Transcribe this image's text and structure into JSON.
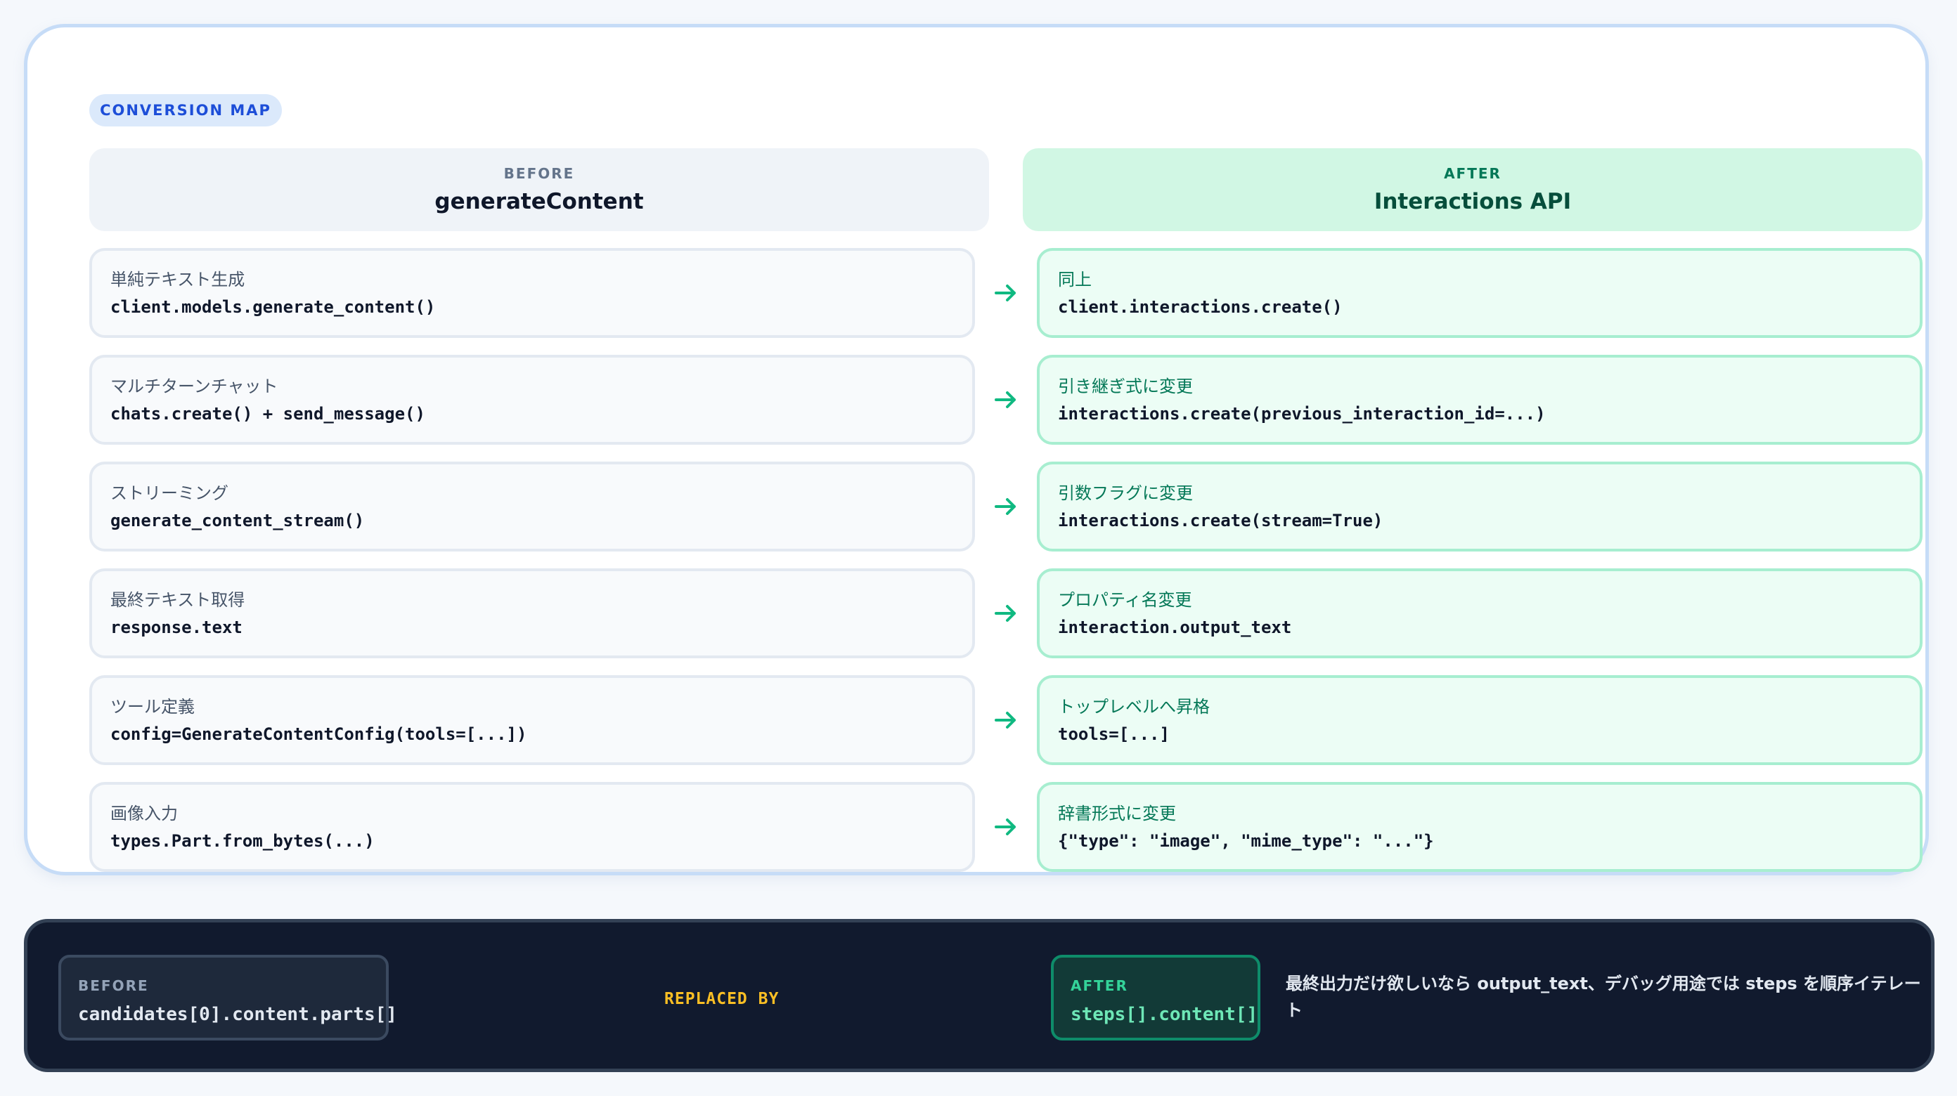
{
  "badge": "CONVERSION MAP",
  "before_header": {
    "label": "BEFORE",
    "title": "generateContent"
  },
  "after_header": {
    "label": "AFTER",
    "title": "Interactions API"
  },
  "rows": [
    {
      "before_caption": "単純テキスト生成",
      "before_code": "client.models.generate_content()",
      "after_caption": "同上",
      "after_code": "client.interactions.create()"
    },
    {
      "before_caption": "マルチターンチャット",
      "before_code": "chats.create() + send_message()",
      "after_caption": "引き継ぎ式に変更",
      "after_code": "interactions.create(previous_interaction_id=...)"
    },
    {
      "before_caption": "ストリーミング",
      "before_code": "generate_content_stream()",
      "after_caption": "引数フラグに変更",
      "after_code": "interactions.create(stream=True)"
    },
    {
      "before_caption": "最終テキスト取得",
      "before_code": "response.text",
      "after_caption": "プロパティ名変更",
      "after_code": "interaction.output_text"
    },
    {
      "before_caption": "ツール定義",
      "before_code": "config=GenerateContentConfig(tools=[...])",
      "after_caption": "トップレベルへ昇格",
      "after_code": "tools=[...]"
    },
    {
      "before_caption": "画像入力",
      "before_code": "types.Part.from_bytes(...)",
      "after_caption": "辞書形式に変更",
      "after_code": "{\"type\": \"image\", \"mime_type\": \"...\"}"
    }
  ],
  "bottom": {
    "before_label": "BEFORE",
    "before_code": "candidates[0].content.parts[]",
    "replaced_by": "REPLACED BY",
    "after_label": "AFTER",
    "after_code": "steps[].content[]",
    "note": "最終出力だけ欲しいなら output_text、デバッグ用途では steps を順序イテレート"
  },
  "icons": {
    "row_arrow": "arrow-right-icon"
  },
  "colors": {
    "accent_blue": "#1d4ed8",
    "accent_green": "#047857",
    "highlight_yellow": "#fbbf24",
    "dark_bg": "#111a2e"
  }
}
